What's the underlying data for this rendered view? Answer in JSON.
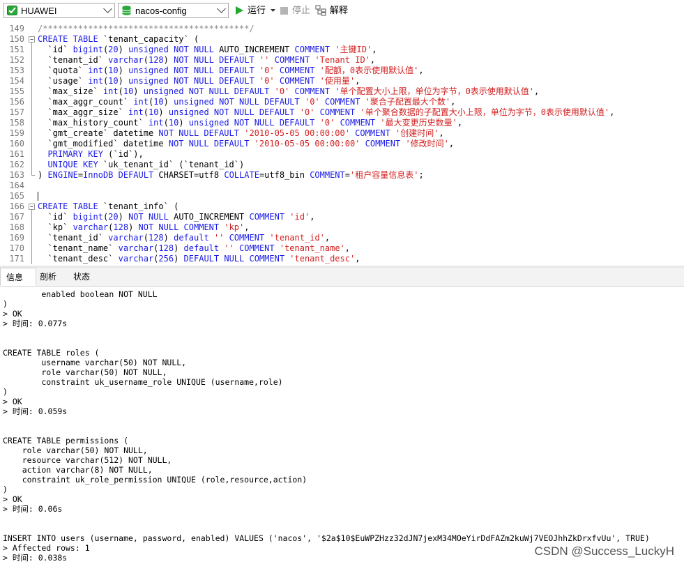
{
  "toolbar": {
    "connection": "HUAWEI",
    "database": "nacos-config",
    "run_label": "运行",
    "stop_label": "停止",
    "explain_label": "解释"
  },
  "editor": {
    "lines": [
      {
        "num": "149",
        "fold": "",
        "segs": [
          [
            "cmt",
            "/*****************************************/"
          ]
        ]
      },
      {
        "num": "150",
        "fold": "open",
        "segs": [
          [
            "kw",
            "CREATE TABLE"
          ],
          [
            "p",
            " `tenant_capacity` ("
          ]
        ]
      },
      {
        "num": "151",
        "fold": "bar",
        "segs": [
          [
            "p",
            "  `id` "
          ],
          [
            "kw",
            "bigint"
          ],
          [
            "p",
            "("
          ],
          [
            "kw",
            "20"
          ],
          [
            "p",
            ") "
          ],
          [
            "kw",
            "unsigned NOT NULL"
          ],
          [
            "p",
            " AUTO_INCREMENT "
          ],
          [
            "kw",
            "COMMENT"
          ],
          [
            "p",
            " "
          ],
          [
            "str",
            "'主键ID'"
          ],
          [
            "p",
            ","
          ]
        ]
      },
      {
        "num": "152",
        "fold": "bar",
        "segs": [
          [
            "p",
            "  `tenant_id` "
          ],
          [
            "kw",
            "varchar"
          ],
          [
            "p",
            "("
          ],
          [
            "kw",
            "128"
          ],
          [
            "p",
            ") "
          ],
          [
            "kw",
            "NOT NULL DEFAULT"
          ],
          [
            "p",
            " "
          ],
          [
            "str",
            "''"
          ],
          [
            "p",
            " "
          ],
          [
            "kw",
            "COMMENT"
          ],
          [
            "p",
            " "
          ],
          [
            "str",
            "'Tenant ID'"
          ],
          [
            "p",
            ","
          ]
        ]
      },
      {
        "num": "153",
        "fold": "bar",
        "segs": [
          [
            "p",
            "  `quota` "
          ],
          [
            "kw",
            "int"
          ],
          [
            "p",
            "("
          ],
          [
            "kw",
            "10"
          ],
          [
            "p",
            ") "
          ],
          [
            "kw",
            "unsigned NOT NULL DEFAULT"
          ],
          [
            "p",
            " "
          ],
          [
            "str",
            "'0'"
          ],
          [
            "p",
            " "
          ],
          [
            "kw",
            "COMMENT"
          ],
          [
            "p",
            " "
          ],
          [
            "str",
            "'配额，0表示使用默认值'"
          ],
          [
            "p",
            ","
          ]
        ]
      },
      {
        "num": "154",
        "fold": "bar",
        "segs": [
          [
            "p",
            "  `usage` "
          ],
          [
            "kw",
            "int"
          ],
          [
            "p",
            "("
          ],
          [
            "kw",
            "10"
          ],
          [
            "p",
            ") "
          ],
          [
            "kw",
            "unsigned NOT NULL DEFAULT"
          ],
          [
            "p",
            " "
          ],
          [
            "str",
            "'0'"
          ],
          [
            "p",
            " "
          ],
          [
            "kw",
            "COMMENT"
          ],
          [
            "p",
            " "
          ],
          [
            "str",
            "'使用量'"
          ],
          [
            "p",
            ","
          ]
        ]
      },
      {
        "num": "155",
        "fold": "bar",
        "segs": [
          [
            "p",
            "  `max_size` "
          ],
          [
            "kw",
            "int"
          ],
          [
            "p",
            "("
          ],
          [
            "kw",
            "10"
          ],
          [
            "p",
            ") "
          ],
          [
            "kw",
            "unsigned NOT NULL DEFAULT"
          ],
          [
            "p",
            " "
          ],
          [
            "str",
            "'0'"
          ],
          [
            "p",
            " "
          ],
          [
            "kw",
            "COMMENT"
          ],
          [
            "p",
            " "
          ],
          [
            "str",
            "'单个配置大小上限，单位为字节，0表示使用默认值'"
          ],
          [
            "p",
            ","
          ]
        ]
      },
      {
        "num": "156",
        "fold": "bar",
        "segs": [
          [
            "p",
            "  `max_aggr_count` "
          ],
          [
            "kw",
            "int"
          ],
          [
            "p",
            "("
          ],
          [
            "kw",
            "10"
          ],
          [
            "p",
            ") "
          ],
          [
            "kw",
            "unsigned NOT NULL DEFAULT"
          ],
          [
            "p",
            " "
          ],
          [
            "str",
            "'0'"
          ],
          [
            "p",
            " "
          ],
          [
            "kw",
            "COMMENT"
          ],
          [
            "p",
            " "
          ],
          [
            "str",
            "'聚合子配置最大个数'"
          ],
          [
            "p",
            ","
          ]
        ]
      },
      {
        "num": "157",
        "fold": "bar",
        "segs": [
          [
            "p",
            "  `max_aggr_size` "
          ],
          [
            "kw",
            "int"
          ],
          [
            "p",
            "("
          ],
          [
            "kw",
            "10"
          ],
          [
            "p",
            ") "
          ],
          [
            "kw",
            "unsigned NOT NULL DEFAULT"
          ],
          [
            "p",
            " "
          ],
          [
            "str",
            "'0'"
          ],
          [
            "p",
            " "
          ],
          [
            "kw",
            "COMMENT"
          ],
          [
            "p",
            " "
          ],
          [
            "str",
            "'单个聚合数据的子配置大小上限，单位为字节，0表示使用默认值'"
          ],
          [
            "p",
            ","
          ]
        ]
      },
      {
        "num": "158",
        "fold": "bar",
        "segs": [
          [
            "p",
            "  `max_history_count` "
          ],
          [
            "kw",
            "int"
          ],
          [
            "p",
            "("
          ],
          [
            "kw",
            "10"
          ],
          [
            "p",
            ") "
          ],
          [
            "kw",
            "unsigned NOT NULL DEFAULT"
          ],
          [
            "p",
            " "
          ],
          [
            "str",
            "'0'"
          ],
          [
            "p",
            " "
          ],
          [
            "kw",
            "COMMENT"
          ],
          [
            "p",
            " "
          ],
          [
            "str",
            "'最大变更历史数量'"
          ],
          [
            "p",
            ","
          ]
        ]
      },
      {
        "num": "159",
        "fold": "bar",
        "segs": [
          [
            "p",
            "  `gmt_create` datetime "
          ],
          [
            "kw",
            "NOT NULL DEFAULT"
          ],
          [
            "p",
            " "
          ],
          [
            "str",
            "'2010-05-05 00:00:00'"
          ],
          [
            "p",
            " "
          ],
          [
            "kw",
            "COMMENT"
          ],
          [
            "p",
            " "
          ],
          [
            "str",
            "'创建时间'"
          ],
          [
            "p",
            ","
          ]
        ]
      },
      {
        "num": "160",
        "fold": "bar",
        "segs": [
          [
            "p",
            "  `gmt_modified` datetime "
          ],
          [
            "kw",
            "NOT NULL DEFAULT"
          ],
          [
            "p",
            " "
          ],
          [
            "str",
            "'2010-05-05 00:00:00'"
          ],
          [
            "p",
            " "
          ],
          [
            "kw",
            "COMMENT"
          ],
          [
            "p",
            " "
          ],
          [
            "str",
            "'修改时间'"
          ],
          [
            "p",
            ","
          ]
        ]
      },
      {
        "num": "161",
        "fold": "bar",
        "segs": [
          [
            "p",
            "  "
          ],
          [
            "kw",
            "PRIMARY KEY"
          ],
          [
            "p",
            " (`id`),"
          ]
        ]
      },
      {
        "num": "162",
        "fold": "bar",
        "segs": [
          [
            "p",
            "  "
          ],
          [
            "kw",
            "UNIQUE KEY"
          ],
          [
            "p",
            " `uk_tenant_id` (`tenant_id`)"
          ]
        ]
      },
      {
        "num": "163",
        "fold": "end",
        "segs": [
          [
            "p",
            ") "
          ],
          [
            "kw",
            "ENGINE"
          ],
          [
            "p",
            "="
          ],
          [
            "kw",
            "InnoDB DEFAULT"
          ],
          [
            "p",
            " CHARSET=utf8 "
          ],
          [
            "kw",
            "COLLATE"
          ],
          [
            "p",
            "=utf8_bin "
          ],
          [
            "kw",
            "COMMENT"
          ],
          [
            "p",
            "="
          ],
          [
            "str",
            "'租户容量信息表'"
          ],
          [
            "p",
            ";"
          ]
        ]
      },
      {
        "num": "164",
        "fold": "",
        "segs": [
          [
            "p",
            ""
          ]
        ]
      },
      {
        "num": "165",
        "fold": "",
        "segs": [
          [
            "p",
            ""
          ]
        ]
      },
      {
        "num": "166",
        "fold": "open",
        "segs": [
          [
            "kw",
            "CREATE TABLE"
          ],
          [
            "p",
            " `tenant_info` ("
          ]
        ]
      },
      {
        "num": "167",
        "fold": "bar",
        "segs": [
          [
            "p",
            "  `id` "
          ],
          [
            "kw",
            "bigint"
          ],
          [
            "p",
            "("
          ],
          [
            "kw",
            "20"
          ],
          [
            "p",
            ") "
          ],
          [
            "kw",
            "NOT NULL"
          ],
          [
            "p",
            " AUTO_INCREMENT "
          ],
          [
            "kw",
            "COMMENT"
          ],
          [
            "p",
            " "
          ],
          [
            "str",
            "'id'"
          ],
          [
            "p",
            ","
          ]
        ]
      },
      {
        "num": "168",
        "fold": "bar",
        "segs": [
          [
            "p",
            "  `kp` "
          ],
          [
            "kw",
            "varchar"
          ],
          [
            "p",
            "("
          ],
          [
            "kw",
            "128"
          ],
          [
            "p",
            ") "
          ],
          [
            "kw",
            "NOT NULL COMMENT"
          ],
          [
            "p",
            " "
          ],
          [
            "str",
            "'kp'"
          ],
          [
            "p",
            ","
          ]
        ]
      },
      {
        "num": "169",
        "fold": "bar",
        "segs": [
          [
            "p",
            "  `tenant_id` "
          ],
          [
            "kw",
            "varchar"
          ],
          [
            "p",
            "("
          ],
          [
            "kw",
            "128"
          ],
          [
            "p",
            ") "
          ],
          [
            "kw",
            "default"
          ],
          [
            "p",
            " "
          ],
          [
            "str",
            "''"
          ],
          [
            "p",
            " "
          ],
          [
            "kw",
            "COMMENT"
          ],
          [
            "p",
            " "
          ],
          [
            "str",
            "'tenant_id'"
          ],
          [
            "p",
            ","
          ]
        ]
      },
      {
        "num": "170",
        "fold": "bar",
        "segs": [
          [
            "p",
            "  `tenant_name` "
          ],
          [
            "kw",
            "varchar"
          ],
          [
            "p",
            "("
          ],
          [
            "kw",
            "128"
          ],
          [
            "p",
            ") "
          ],
          [
            "kw",
            "default"
          ],
          [
            "p",
            " "
          ],
          [
            "str",
            "''"
          ],
          [
            "p",
            " "
          ],
          [
            "kw",
            "COMMENT"
          ],
          [
            "p",
            " "
          ],
          [
            "str",
            "'tenant_name'"
          ],
          [
            "p",
            ","
          ]
        ]
      },
      {
        "num": "171",
        "fold": "bar",
        "segs": [
          [
            "p",
            "  `tenant_desc` "
          ],
          [
            "kw",
            "varchar"
          ],
          [
            "p",
            "("
          ],
          [
            "kw",
            "256"
          ],
          [
            "p",
            ") "
          ],
          [
            "kw",
            "DEFAULT NULL COMMENT"
          ],
          [
            "p",
            " "
          ],
          [
            "str",
            "'tenant_desc'"
          ],
          [
            "p",
            ","
          ]
        ]
      }
    ]
  },
  "tabs": [
    "信息",
    "剖析",
    "状态"
  ],
  "output": {
    "lines": [
      "        enabled boolean NOT NULL",
      ")",
      "> OK",
      "> 时间: 0.077s",
      "",
      "",
      "CREATE TABLE roles (",
      "        username varchar(50) NOT NULL,",
      "        role varchar(50) NOT NULL,",
      "        constraint uk_username_role UNIQUE (username,role)",
      ")",
      "> OK",
      "> 时间: 0.059s",
      "",
      "",
      "CREATE TABLE permissions (",
      "    role varchar(50) NOT NULL,",
      "    resource varchar(512) NOT NULL,",
      "    action varchar(8) NOT NULL,",
      "    constraint uk_role_permission UNIQUE (role,resource,action)",
      ")",
      "> OK",
      "> 时间: 0.06s",
      "",
      "",
      "INSERT INTO users (username, password, enabled) VALUES ('nacos', '$2a$10$EuWPZHzz32dJN7jexM34MOeYirDdFAZm2kuWj7VEOJhhZkDrxfvUu', TRUE)",
      "> Affected rows: 1",
      "> 时间: 0.038s"
    ]
  },
  "watermark": "CSDN @Success_LuckyH",
  "colors": {
    "keyword": "#1a1ae6",
    "string": "#d21e1e",
    "comment": "#8a8a8a",
    "run_icon": "#22a82d",
    "db_icon": "#2aa83a"
  }
}
